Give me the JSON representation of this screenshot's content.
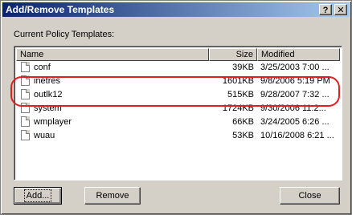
{
  "window": {
    "title": "Add/Remove Templates",
    "help_label": "?",
    "close_label": "✕"
  },
  "list_label": "Current Policy Templates:",
  "columns": {
    "name": "Name",
    "size": "Size",
    "modified": "Modified"
  },
  "rows": [
    {
      "name": "conf",
      "size": "39KB",
      "modified": "3/25/2003 7:00 ..."
    },
    {
      "name": "inetres",
      "size": "1601KB",
      "modified": "9/8/2006 5:19 PM"
    },
    {
      "name": "outlk12",
      "size": "515KB",
      "modified": "9/28/2007 7:32 ..."
    },
    {
      "name": "system",
      "size": "1724KB",
      "modified": "9/30/2006 11:2..."
    },
    {
      "name": "wmplayer",
      "size": "66KB",
      "modified": "3/24/2005 6:26 ..."
    },
    {
      "name": "wuau",
      "size": "53KB",
      "modified": "10/16/2008 6:21 ..."
    }
  ],
  "buttons": {
    "add": "Add...",
    "remove": "Remove",
    "close": "Close"
  },
  "colors": {
    "highlight_circle": "#e02020"
  }
}
